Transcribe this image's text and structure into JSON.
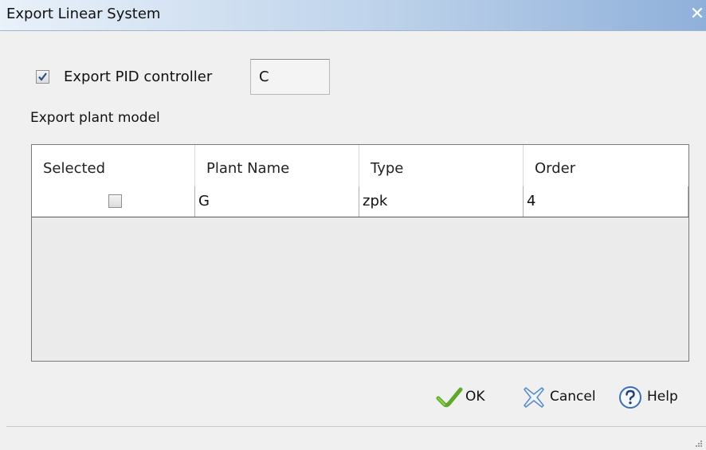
{
  "window": {
    "title": "Export Linear System",
    "close_symbol": "✕"
  },
  "pid": {
    "checked": true,
    "label": "Export PID controller",
    "name_value": "C"
  },
  "plant": {
    "section_label": "Export plant model",
    "columns": [
      "Selected",
      "Plant Name",
      "Type",
      "Order"
    ],
    "rows": [
      {
        "selected": false,
        "name": "G",
        "type": "zpk",
        "order": "4"
      }
    ]
  },
  "buttons": {
    "ok_label": "OK",
    "cancel_label": "Cancel",
    "help_label": "Help"
  },
  "icons": {
    "ok": "checkmark-icon",
    "cancel": "x-cross-icon",
    "help": "question-circle-icon",
    "close": "close-icon"
  },
  "colors": {
    "titlebar_start": "#e9f1fa",
    "titlebar_end": "#8fb0da",
    "ok_check_green": "#5fa82a",
    "cancel_blue": "#5b8dc8",
    "help_blue": "#3a6fb5"
  }
}
